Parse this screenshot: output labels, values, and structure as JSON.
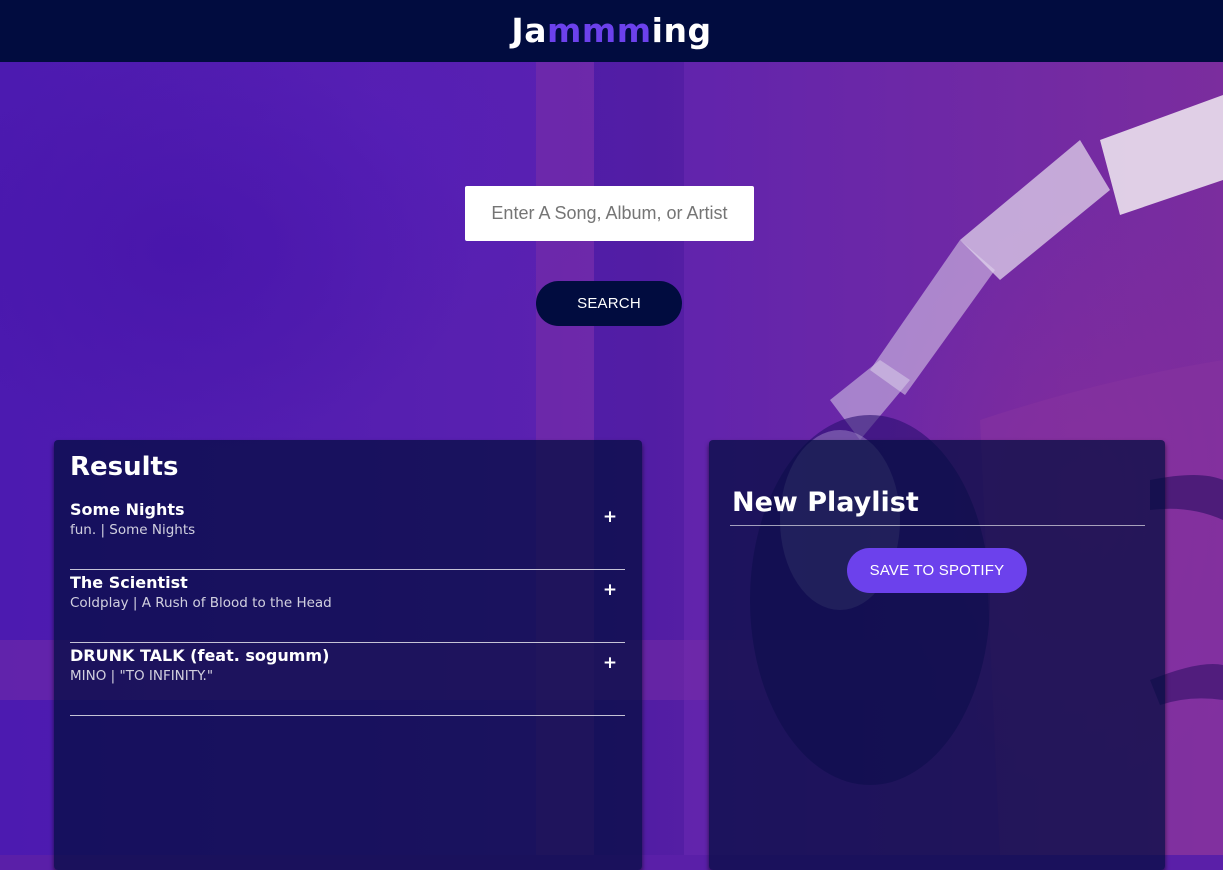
{
  "app": {
    "logo_prefix": "Ja",
    "logo_accent": "mmm",
    "logo_suffix": "ing"
  },
  "search": {
    "placeholder": "Enter A Song, Album, or Artist",
    "value": "",
    "button_label": "SEARCH"
  },
  "results": {
    "title": "Results",
    "add_symbol": "+",
    "tracks": [
      {
        "name": "Some Nights",
        "info": "fun. | Some Nights"
      },
      {
        "name": "The Scientist",
        "info": "Coldplay | A Rush of Blood to the Head"
      },
      {
        "name": "DRUNK TALK (feat. sogumm)",
        "info": "MINO | \"TO INFINITY.\""
      }
    ]
  },
  "playlist": {
    "name": "New Playlist",
    "save_label": "SAVE TO SPOTIFY"
  },
  "colors": {
    "header_bg": "#010c3f",
    "accent": "#6c41ec",
    "panel_bg": "rgba(1, 12, 63, 0.72)"
  },
  "icons": {
    "add_track": "plus-icon"
  }
}
